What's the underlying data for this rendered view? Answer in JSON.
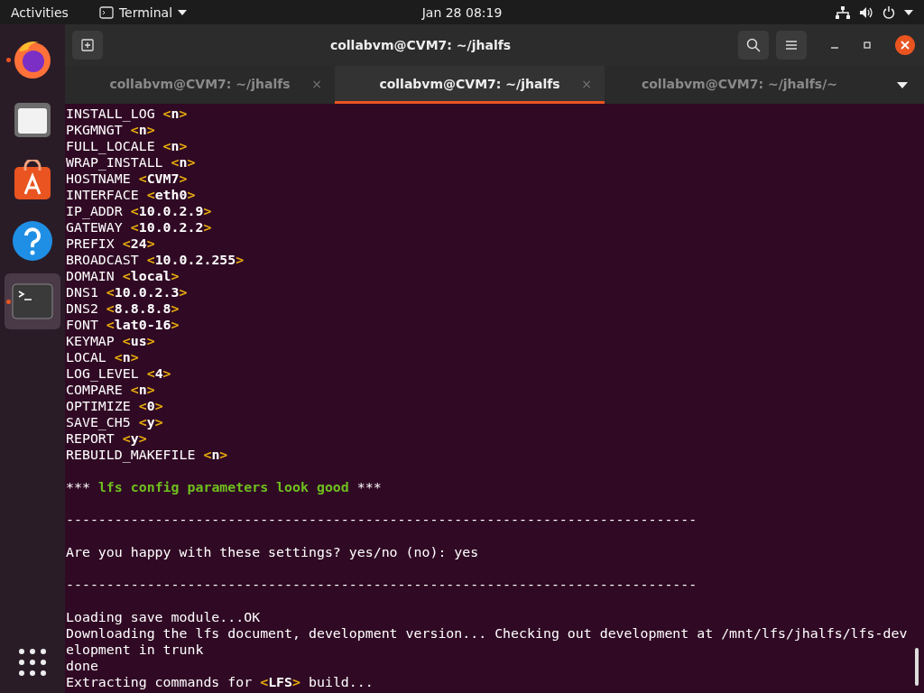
{
  "top_bar": {
    "activities": "Activities",
    "app_menu": "Terminal",
    "clock": "Jan 28  08:19"
  },
  "dock": {
    "items": [
      {
        "kind": "firefox",
        "running": true,
        "selected": false
      },
      {
        "kind": "files",
        "running": false,
        "selected": false
      },
      {
        "kind": "software",
        "running": false,
        "selected": false
      },
      {
        "kind": "help",
        "running": false,
        "selected": false
      },
      {
        "kind": "terminal",
        "running": true,
        "selected": true
      }
    ]
  },
  "window": {
    "title": "collabvm@CVM7: ~/jhalfs"
  },
  "tabs": [
    {
      "label": "collabvm@CVM7: ~/jhalfs",
      "selected": false,
      "close": "×"
    },
    {
      "label": "collabvm@CVM7: ~/jhalfs",
      "selected": true,
      "close": "×"
    },
    {
      "label": "collabvm@CVM7: ~/jhalfs/~",
      "selected": false
    }
  ],
  "terminal": {
    "lines": [
      {
        "kind": "param",
        "name": "INSTALL_LOG",
        "value": "<n>"
      },
      {
        "kind": "param",
        "name": "PKGMNGT",
        "value": "<n>"
      },
      {
        "kind": "param",
        "name": "FULL_LOCALE",
        "value": "<n>"
      },
      {
        "kind": "param",
        "name": "WRAP_INSTALL",
        "value": "<n>"
      },
      {
        "kind": "param",
        "name": "HOSTNAME",
        "value": "<CVM7>"
      },
      {
        "kind": "param",
        "name": "INTERFACE",
        "value": "<eth0>"
      },
      {
        "kind": "param",
        "name": "IP_ADDR",
        "value": "<10.0.2.9>"
      },
      {
        "kind": "param",
        "name": "GATEWAY",
        "value": "<10.0.2.2>"
      },
      {
        "kind": "param",
        "name": "PREFIX",
        "value": "<24>"
      },
      {
        "kind": "param",
        "name": "BROADCAST",
        "value": "<10.0.2.255>"
      },
      {
        "kind": "param",
        "name": "DOMAIN",
        "value": "<local>"
      },
      {
        "kind": "param",
        "name": "DNS1",
        "value": "<10.0.2.3>"
      },
      {
        "kind": "param",
        "name": "DNS2",
        "value": "<8.8.8.8>"
      },
      {
        "kind": "param",
        "name": "FONT",
        "value": "<lat0-16>"
      },
      {
        "kind": "param",
        "name": "KEYMAP",
        "value": "<us>"
      },
      {
        "kind": "param",
        "name": "LOCAL",
        "value": "<n>"
      },
      {
        "kind": "param",
        "name": "LOG_LEVEL",
        "value": "<4>"
      },
      {
        "kind": "param",
        "name": "COMPARE",
        "value": "<n>"
      },
      {
        "kind": "param",
        "name": "OPTIMIZE",
        "value": "<0>"
      },
      {
        "kind": "param",
        "name": "SAVE_CH5",
        "value": "<y>"
      },
      {
        "kind": "param",
        "name": "REPORT",
        "value": "<y>"
      },
      {
        "kind": "param",
        "name": "REBUILD_MAKEFILE",
        "value": "<n>"
      },
      {
        "kind": "blank"
      },
      {
        "kind": "success",
        "stars": "***",
        "text": "lfs config parameters look good",
        "end": "***"
      },
      {
        "kind": "blank"
      },
      {
        "kind": "text",
        "text": "------------------------------------------------------------------------------"
      },
      {
        "kind": "blank"
      },
      {
        "kind": "text",
        "text": "Are you happy with these settings? yes/no (no): yes"
      },
      {
        "kind": "blank"
      },
      {
        "kind": "text",
        "text": "------------------------------------------------------------------------------"
      },
      {
        "kind": "blank"
      },
      {
        "kind": "text",
        "text": "Loading save module...OK"
      },
      {
        "kind": "text",
        "text": "Downloading the lfs document, development version... Checking out development at /mnt/lfs/jhalfs/lfs-dev"
      },
      {
        "kind": "text",
        "text": "elopment in trunk"
      },
      {
        "kind": "text",
        "text": "done"
      },
      {
        "kind": "param",
        "name": "Extracting commands for",
        "value": "<LFS>",
        "after": "build..."
      }
    ]
  }
}
